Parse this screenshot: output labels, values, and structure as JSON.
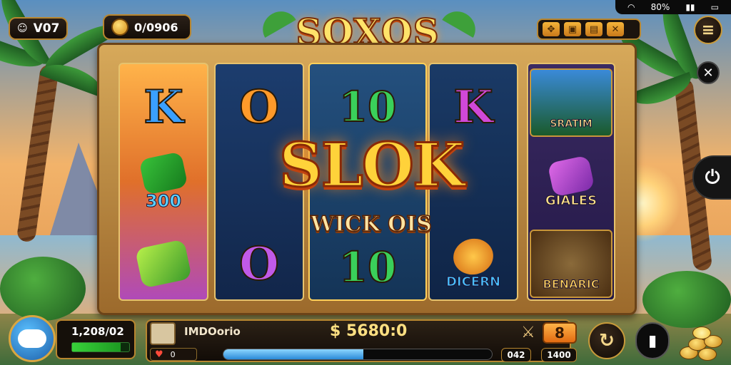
{
  "status_bar": {
    "wifi_icon": "wifi-icon",
    "battery_text": "80%",
    "signal_text": "%",
    "signal_icon": "signal-icon",
    "battery_icon": "battery-icon"
  },
  "top_left": {
    "version": "V07",
    "coins": "0/0906"
  },
  "logo": {
    "text": "SOXOS"
  },
  "hud_icons": [
    "compass-icon",
    "chest-icon",
    "card-icon",
    "scroll-icon"
  ],
  "reels": {
    "reel1": [
      "K",
      "300"
    ],
    "reel2": [
      "O",
      "O"
    ],
    "reel3": [
      "10",
      "10"
    ],
    "reel4": [
      "K",
      "DICERN"
    ],
    "reel5": [
      "SRATIM",
      "GIALES",
      "BENARIC"
    ]
  },
  "bigwin": {
    "title": "SLOK",
    "subtitle": "WICK OIS"
  },
  "bottom": {
    "player_score": "1,208/02",
    "player_name": "IMDOorio",
    "balance": "$ 5680:0",
    "heart_count": "0",
    "bet_value": "8",
    "left_counter": "042",
    "right_counter": "1400",
    "xp_percent": 85,
    "progress_percent": 52
  },
  "colors": {
    "gold": "#ffd23a",
    "frame": "#d7a95a",
    "accent_orange": "#e26b12",
    "progress_blue": "#2a8ad8"
  }
}
